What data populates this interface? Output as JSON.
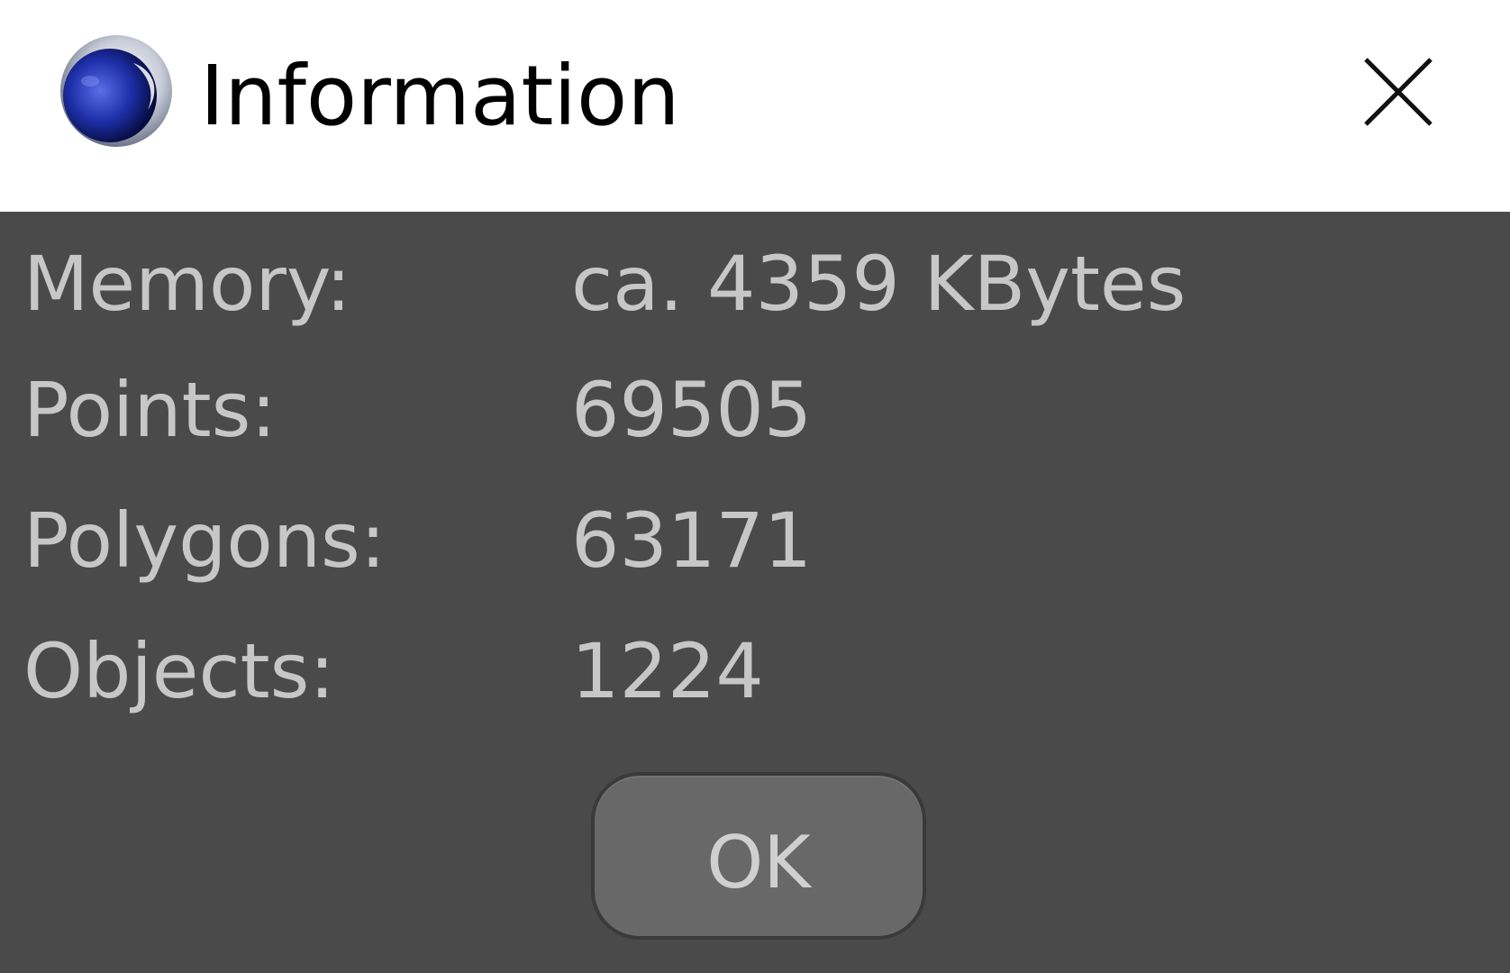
{
  "window": {
    "title": "Information",
    "icon": "cinema4d-app-icon",
    "close_icon": "close-icon"
  },
  "info": [
    {
      "label": "Memory:",
      "value": "ca. 4359 KBytes"
    },
    {
      "label": "Points:",
      "value": "69505"
    },
    {
      "label": "Polygons:",
      "value": "63171"
    },
    {
      "label": "Objects:",
      "value": "1224"
    }
  ],
  "buttons": {
    "ok_label": "OK"
  },
  "colors": {
    "titlebar_bg": "#ffffff",
    "content_bg": "#4a4a4a",
    "text": "#c7c7c7",
    "button_bg": "#686868"
  }
}
